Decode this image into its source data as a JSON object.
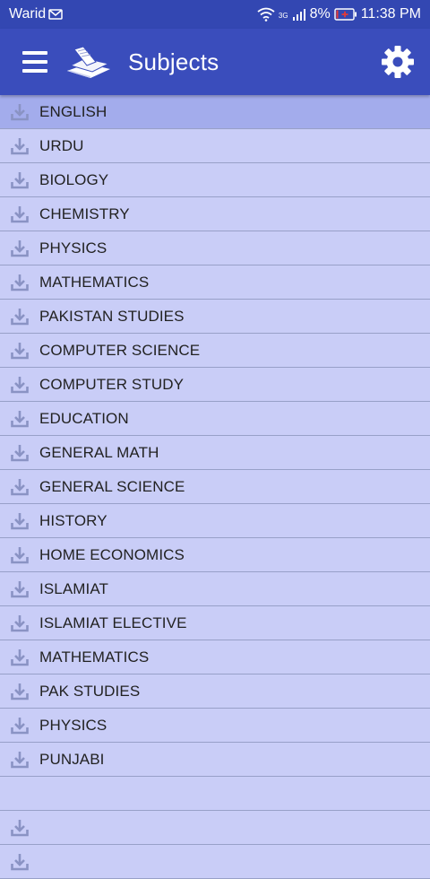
{
  "status_bar": {
    "carrier": "Warid",
    "network": "3G",
    "battery": "8%",
    "time": "11:38 PM",
    "icons": [
      "message-icon",
      "wifi-icon",
      "signal-icon",
      "battery-charging-icon"
    ]
  },
  "app_bar": {
    "title": "Subjects",
    "icons": [
      "menu-icon",
      "books-logo-icon",
      "gear-icon"
    ]
  },
  "subjects": [
    {
      "label": "ENGLISH",
      "selected": true
    },
    {
      "label": "URDU"
    },
    {
      "label": "BIOLOGY"
    },
    {
      "label": "CHEMISTRY"
    },
    {
      "label": "PHYSICS"
    },
    {
      "label": "MATHEMATICS"
    },
    {
      "label": "PAKISTAN STUDIES"
    },
    {
      "label": "COMPUTER SCIENCE"
    },
    {
      "label": "COMPUTER STUDY"
    },
    {
      "label": "EDUCATION"
    },
    {
      "label": "GENERAL MATH"
    },
    {
      "label": "GENERAL SCIENCE"
    },
    {
      "label": "HISTORY"
    },
    {
      "label": "HOME ECONOMICS"
    },
    {
      "label": "ISLAMIAT"
    },
    {
      "label": "ISLAMIAT ELECTIVE"
    },
    {
      "label": "MATHEMATICS"
    },
    {
      "label": "PAK STUDIES"
    },
    {
      "label": "PHYSICS"
    },
    {
      "label": "PUNJABI"
    }
  ],
  "colors": {
    "app_bar": "#3a4dbc",
    "status_bar": "#3347b2",
    "list_background": "#c9cdf7",
    "selected_row": "#a3acec",
    "icon": "#8a93c4"
  }
}
